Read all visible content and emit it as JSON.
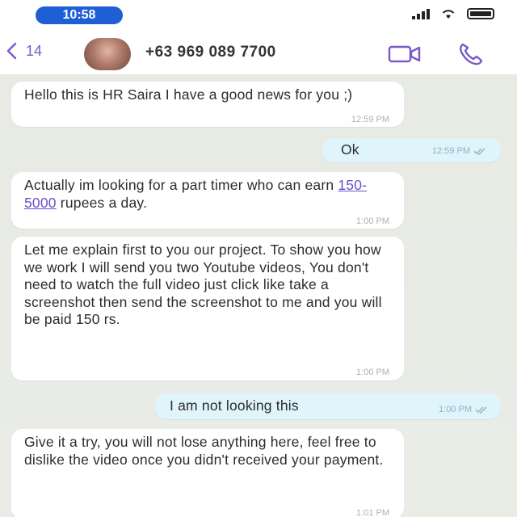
{
  "status_bar": {
    "time": "10:58"
  },
  "header": {
    "back_count": "14",
    "contact_number": "+63 969 089 7700"
  },
  "messages": [
    {
      "direction": "in",
      "text": "Hello this is HR Saira I have a good news for you ;)",
      "time": "12:59 PM"
    },
    {
      "direction": "out",
      "text": "Ok",
      "time": "12:59 PM"
    },
    {
      "direction": "in",
      "text_before": "Actually im looking for a part timer who can earn ",
      "link": "150-5000",
      "text_after": " rupees a day.",
      "time": "1:00 PM"
    },
    {
      "direction": "in",
      "text": "Let me explain first to you our project. To show you how we work I will send you two Youtube videos, You don't need to watch the full video just click like take a screenshot then send the screenshot to me and you will be paid 150 rs.",
      "time": "1:00 PM"
    },
    {
      "direction": "out",
      "text": "I am not looking this",
      "time": "1:00 PM"
    },
    {
      "direction": "in",
      "text": "Give it a try, you will not lose anything here, feel free to dislike the video once you didn't received your payment.",
      "time": "1:01 PM"
    }
  ],
  "colors": {
    "accent": "#7b58c9",
    "incoming_bubble": "#ffffff",
    "outgoing_bubble": "#dff4fb",
    "time_pill": "#1e5fd6",
    "chat_background": "#e9ece6"
  }
}
